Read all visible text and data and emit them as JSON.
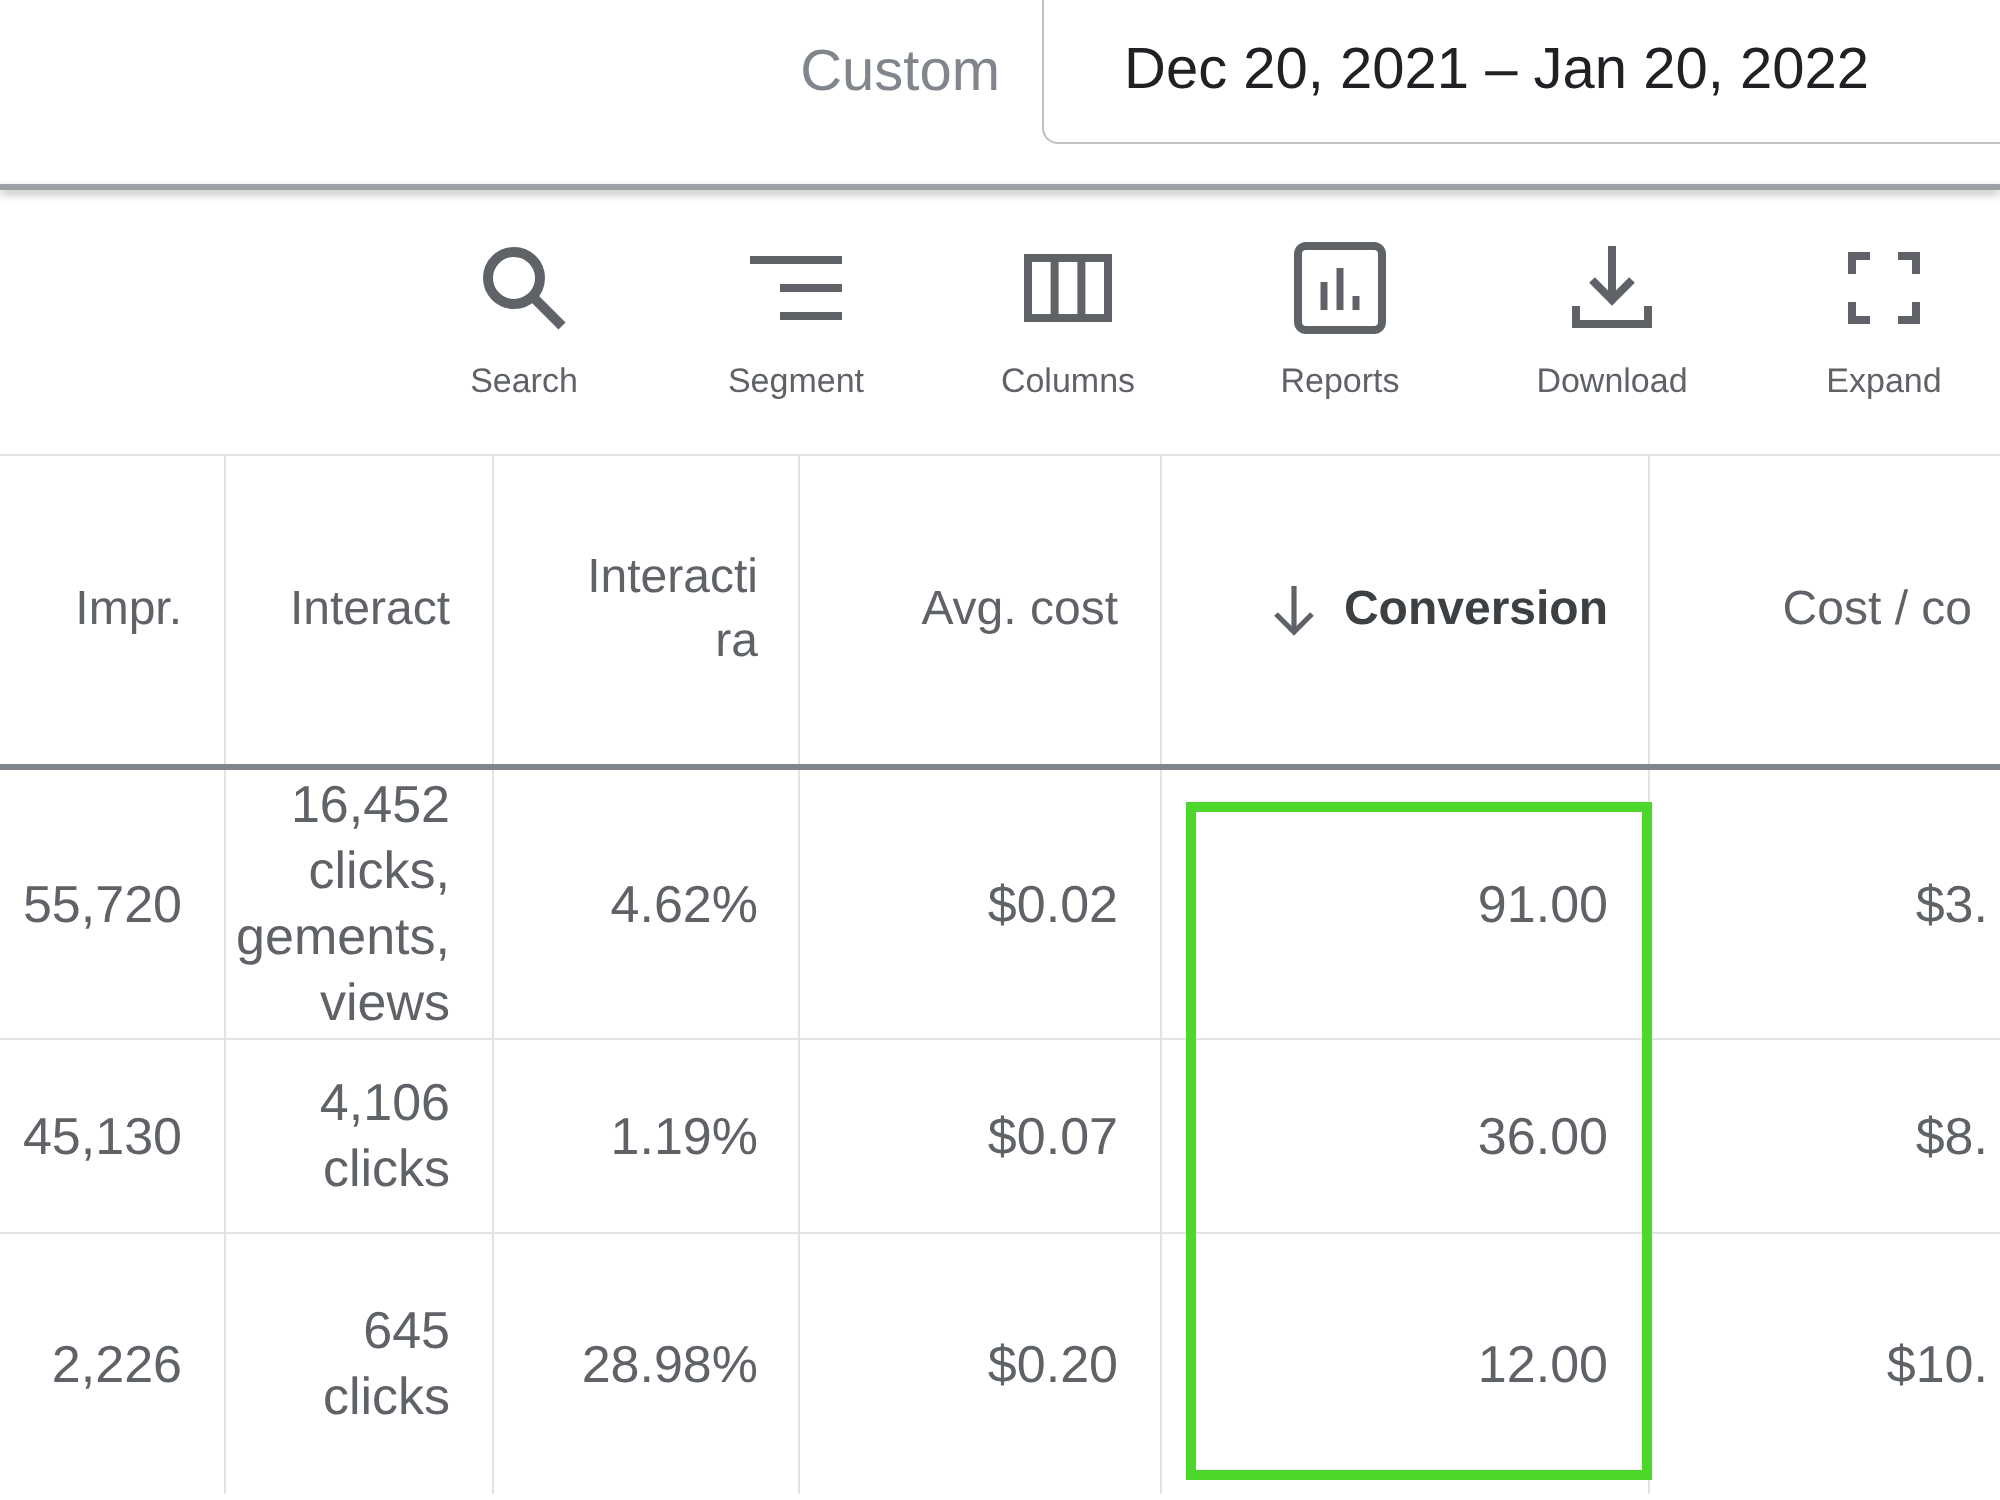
{
  "date_filter": {
    "label": "Custom",
    "range": "Dec 20, 2021 – Jan 20, 2022"
  },
  "toolbar": [
    {
      "kind": "search",
      "label": "Search"
    },
    {
      "kind": "segment",
      "label": "Segment"
    },
    {
      "kind": "columns",
      "label": "Columns"
    },
    {
      "kind": "reports",
      "label": "Reports"
    },
    {
      "kind": "download",
      "label": "Download"
    },
    {
      "kind": "expand",
      "label": "Expand"
    }
  ],
  "table": {
    "columns": [
      {
        "label": "Impr.",
        "sorted": false,
        "highlighted": false
      },
      {
        "label": "Interact",
        "sorted": false,
        "highlighted": false
      },
      {
        "label": "Interacti\nra",
        "sorted": false,
        "highlighted": false
      },
      {
        "label": "Avg. cost",
        "sorted": false,
        "highlighted": false
      },
      {
        "label": "Conversion",
        "sorted": true,
        "highlighted": true
      },
      {
        "label": "Cost / co",
        "sorted": false,
        "highlighted": false
      }
    ],
    "rows": [
      [
        "55,720",
        "16,452\nclicks,\ngements,\nviews",
        "4.62%",
        "$0.02",
        "91.00",
        "$3."
      ],
      [
        "45,130",
        "4,106\nclicks",
        "1.19%",
        "$0.07",
        "36.00",
        "$8."
      ],
      [
        "2,226",
        "645\nclicks",
        "28.98%",
        "$0.20",
        "12.00",
        "$10."
      ]
    ]
  }
}
